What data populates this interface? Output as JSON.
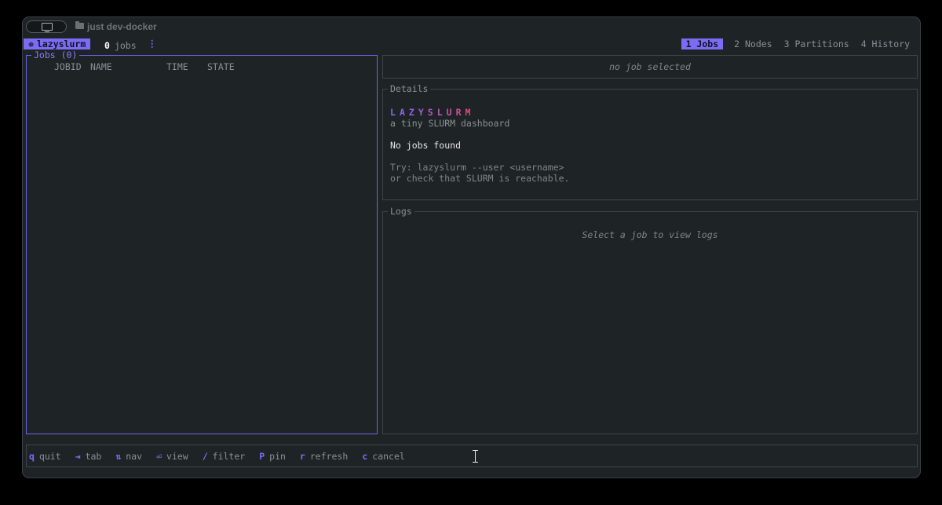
{
  "window": {
    "title": "just dev-docker"
  },
  "status": {
    "app_name": "lazyslurm",
    "app_icon": "❅",
    "job_count": "0",
    "job_count_label": "jobs",
    "menu_glyph": "⋮"
  },
  "tabs": [
    {
      "label": "1 Jobs",
      "active": true
    },
    {
      "label": "2 Nodes",
      "active": false
    },
    {
      "label": "3 Partitions",
      "active": false
    },
    {
      "label": "4 History",
      "active": false
    }
  ],
  "jobs_panel": {
    "title": "Jobs (0)",
    "columns": [
      "JOBID",
      "NAME",
      "TIME",
      "STATE"
    ]
  },
  "job_header": {
    "placeholder": "no job selected"
  },
  "details": {
    "title": "Details",
    "brand": "LAZYSLURM",
    "tagline": "a tiny SLURM dashboard",
    "message": "No jobs found",
    "hint_line1": "Try: lazyslurm --user <username>",
    "hint_line2": "or check that SLURM is reachable."
  },
  "logs": {
    "title": "Logs",
    "placeholder": "Select a job to view logs"
  },
  "keybindings": [
    {
      "key": "q",
      "label": "quit"
    },
    {
      "key": "⇥",
      "label": "tab"
    },
    {
      "key": "⇅",
      "label": "nav"
    },
    {
      "key": "⏎",
      "label": "view"
    },
    {
      "key": "/",
      "label": "filter"
    },
    {
      "key": "P",
      "label": "pin"
    },
    {
      "key": "r",
      "label": "refresh"
    },
    {
      "key": "c",
      "label": "cancel"
    }
  ],
  "colors": {
    "accent": "#7b6cf6",
    "brand_gradient_start": "#7b6cf6",
    "brand_gradient_end": "#e0488a",
    "panel_border": "#3f454b",
    "background": "#1e2326"
  }
}
